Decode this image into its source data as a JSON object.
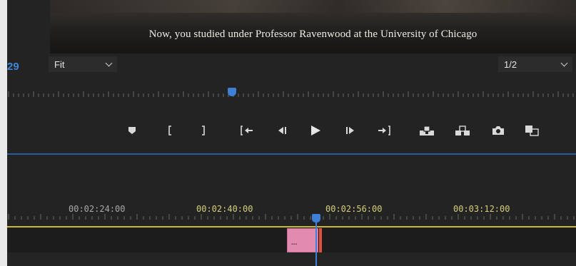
{
  "video": {
    "caption": "Now, you studied under Professor Ravenwood at the University of Chicago"
  },
  "controls": {
    "timecode_partial": "29",
    "zoom_select": {
      "value": "Fit"
    },
    "resolution_select": {
      "value": "1/2"
    }
  },
  "transport": {
    "buttons": [
      "add-marker",
      "mark-in",
      "mark-out",
      "go-to-in",
      "step-back",
      "play",
      "step-forward",
      "go-to-out",
      "lift",
      "extract",
      "export-frame",
      "button-editor"
    ]
  },
  "timeline": {
    "labels": [
      "00:02:24:00",
      "00:02:40:00",
      "00:02:56:00",
      "00:03:12:00"
    ],
    "clip_label": "..."
  },
  "colors": {
    "accent_blue": "#3d80d6",
    "yellow_line": "#c9b63a",
    "clip_pink": "#e38ab0",
    "clip_edge_red": "#e0503c"
  }
}
